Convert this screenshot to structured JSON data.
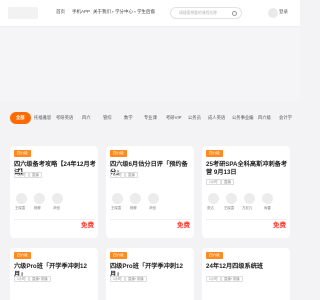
{
  "nav": {
    "items": [
      {
        "label": "首页",
        "has_caret": false
      },
      {
        "label": "手机APP",
        "has_caret": false
      },
      {
        "label": "关于我们",
        "has_caret": true
      },
      {
        "label": "学分中心",
        "has_caret": true
      },
      {
        "label": "学生后裔",
        "has_caret": false
      }
    ],
    "search_placeholder": "请搜索想要的课程名称",
    "login_label": "登录"
  },
  "tabs": [
    "全部",
    "托福雅思",
    "考研英语",
    "四六",
    "管综",
    "数学",
    "专业课",
    "考研VIP",
    "公务员",
    "成人英语",
    "公务事业编",
    "四六级",
    "会计学"
  ],
  "active_tab_index": 0,
  "cards_row1": [
    {
      "tag": "四六级",
      "title": "四六级备考攻略【24年12月考试】",
      "chips": [
        "4小时",
        "直播"
      ],
      "teachers": [
        "王晓霞",
        "杨柳",
        "尹冠"
      ],
      "price": "免费"
    },
    {
      "tag": "四六级",
      "title": "四六级6月估分日评「预约备分」",
      "chips": [
        "1小时",
        "直播"
      ],
      "teachers": [
        "王晓霞",
        "杨柳",
        "尹冠"
      ],
      "price": "免费"
    },
    {
      "tag": "四六级",
      "title": "25考研SPA全科高斯冲刺备考营 9月13日",
      "chips": [
        "1小时",
        "直播"
      ],
      "teachers": [
        "张达",
        "王晓霞",
        "方尼凡",
        "尚雷"
      ],
      "price": "免费"
    }
  ],
  "cards_row2": [
    {
      "tag": "四六级",
      "title": "六级Pro班「开学季冲刺12月」",
      "chips": [
        "1小时",
        "直播+录播"
      ]
    },
    {
      "tag": "四六级",
      "title": "四级Pro班「开学季冲刺12月」",
      "chips": [
        "1小时",
        "直播+录播"
      ]
    },
    {
      "tag": "四六级",
      "title": "24年12月四级系统班",
      "chips": [
        "1小时",
        "直播+录播"
      ]
    }
  ]
}
